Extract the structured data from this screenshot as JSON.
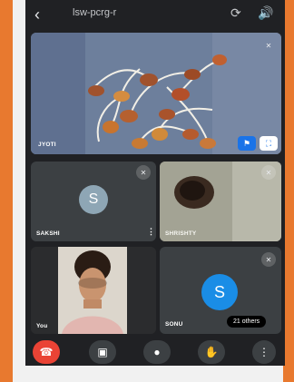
{
  "header": {
    "title": "lsw-pcrg-r",
    "back_icon": "arrow-back-icon",
    "icons": [
      "switch-camera-icon",
      "speaker-icon"
    ]
  },
  "participants": {
    "main": {
      "name": "JYOTI",
      "muted": true
    },
    "sakshi": {
      "name": "SAKSHI",
      "initial": "S",
      "avatar_color": "#8ea6b5",
      "muted": true
    },
    "shrishty": {
      "name": "SHRISHTY",
      "muted": true
    },
    "you": {
      "name": "You"
    },
    "sonu": {
      "name": "SONU",
      "initial": "S",
      "avatar_color": "#1a8de6",
      "muted": true,
      "others_label": "21 others"
    }
  },
  "controls": {
    "end_call": "end-call-icon",
    "camera": "camera-icon",
    "mic": "mic-icon",
    "hand": "raise-hand-icon",
    "more": "more-vert-icon"
  },
  "colors": {
    "frame_border": "#e8792f",
    "end_call_red": "#ea4335",
    "tile_bg": "#3c4043",
    "pin_button": "#1a73e8"
  }
}
